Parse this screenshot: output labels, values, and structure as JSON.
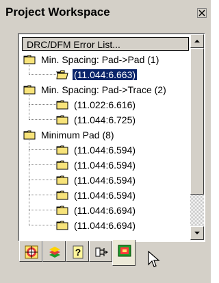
{
  "window": {
    "title": "Project Workspace",
    "close_glyph": "×"
  },
  "tree": {
    "header": "DRC/DFM Error List...",
    "rows": [
      {
        "label": "Min. Spacing: Pad->Pad (1)",
        "level": 0,
        "selected": false
      },
      {
        "label": "(11.044:6.663)",
        "level": 1,
        "selected": true
      },
      {
        "label": "Min. Spacing: Pad->Trace (2)",
        "level": 0,
        "selected": false
      },
      {
        "label": "(11.022:6.616)",
        "level": 1,
        "selected": false
      },
      {
        "label": "(11.044:6.725)",
        "level": 1,
        "selected": false
      },
      {
        "label": "Minimum Pad (8)",
        "level": 0,
        "selected": false
      },
      {
        "label": "(11.044:6.594)",
        "level": 1,
        "selected": false
      },
      {
        "label": "(11.044:6.594)",
        "level": 1,
        "selected": false
      },
      {
        "label": "(11.044:6.594)",
        "level": 1,
        "selected": false
      },
      {
        "label": "(11.044:6.594)",
        "level": 1,
        "selected": false
      },
      {
        "label": "(11.044:6.694)",
        "level": 1,
        "selected": false
      },
      {
        "label": "(11.044:6.694)",
        "level": 1,
        "selected": false
      }
    ]
  },
  "tabs": [
    {
      "icon": "target-icon"
    },
    {
      "icon": "layers-icon"
    },
    {
      "icon": "help-icon"
    },
    {
      "icon": "netlist-icon"
    },
    {
      "icon": "drc-icon",
      "active": true
    }
  ],
  "colors": {
    "panel": "#d4d0c8",
    "selection": "#0a246a",
    "folder": "#f7e37a"
  }
}
